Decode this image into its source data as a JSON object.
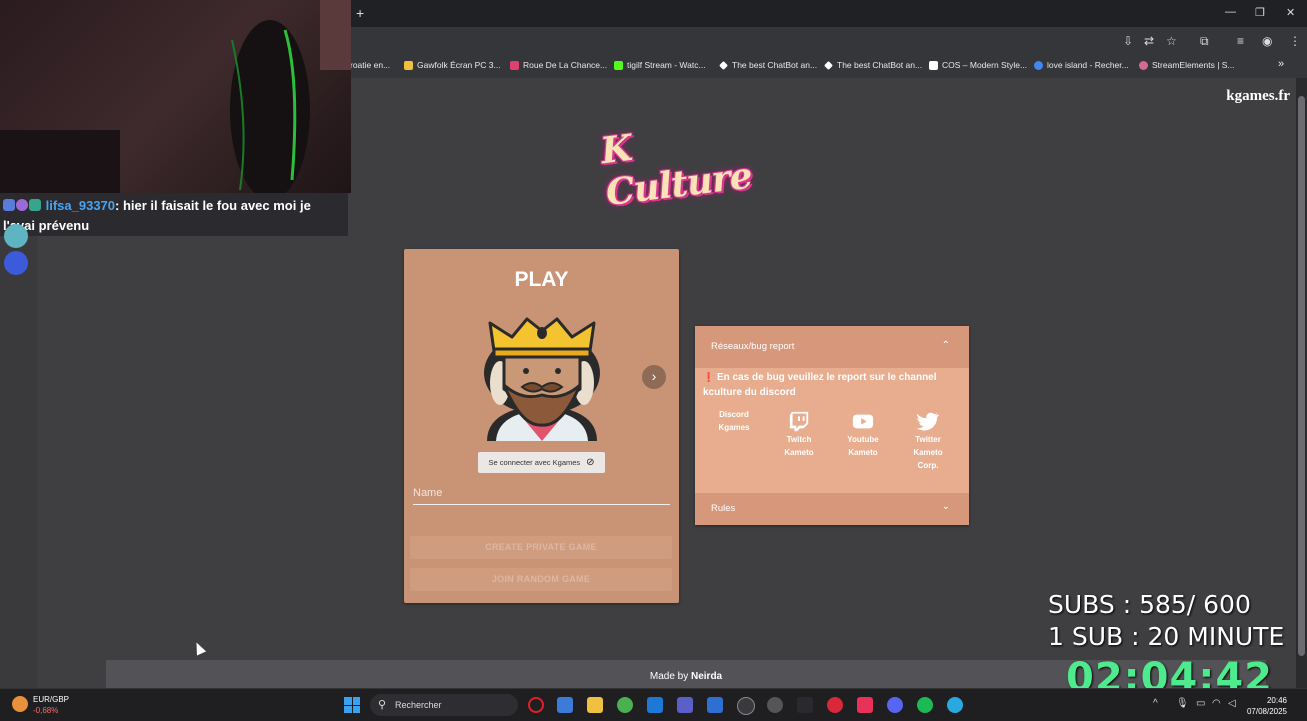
{
  "browser": {
    "new_tab": "+",
    "bookmarks": [
      {
        "label": "roatie en...",
        "color": "#888"
      },
      {
        "label": "Gawfolk Écran PC 3...",
        "color": "#f0c040"
      },
      {
        "label": "Roue De La Chance...",
        "color": "#e04070"
      },
      {
        "label": "tigilf Stream - Watc...",
        "color": "#53fc18"
      },
      {
        "label": "The best ChatBot an...",
        "color": "#ffffff"
      },
      {
        "label": "The best ChatBot an...",
        "color": "#ffffff"
      },
      {
        "label": "COS – Modern Style...",
        "color": "#ffffff"
      },
      {
        "label": "love island - Recher...",
        "color": "#4285f4"
      },
      {
        "label": "StreamElements | S...",
        "color": "#d36b8c"
      }
    ],
    "more": "»"
  },
  "site": {
    "name": "kgames.fr",
    "logo_text": "K Culture"
  },
  "play_card": {
    "title": "PLAY",
    "login_label": "Se connecter avec Kgames",
    "name_placeholder": "Name",
    "create_private": "CREATE PRIVATE GAME",
    "join_random": "JOIN RANDOM GAME"
  },
  "info_panel": {
    "section1_title": "Réseaux/bug report",
    "bug_text": "En cas de bug veuillez le report sur le channel kculture du discord",
    "socials": [
      {
        "line1": "Discord",
        "line2": "Kgames",
        "line3": "",
        "icon": "discord-icon"
      },
      {
        "line1": "Twitch",
        "line2": "Kameto",
        "line3": "",
        "icon": "twitch-icon"
      },
      {
        "line1": "Youtube",
        "line2": "Kameto",
        "line3": "",
        "icon": "youtube-icon"
      },
      {
        "line1": "Twitter",
        "line2": "Kameto",
        "line3": "Corp.",
        "icon": "twitter-icon"
      }
    ],
    "section2_title": "Rules"
  },
  "footer": {
    "prefix": "Made by ",
    "author": "Neirda"
  },
  "stream": {
    "chat_user": "lifsa_93370",
    "chat_message": ": hier il faisait le fou avec moi je l'avai prévenu",
    "subs": "SUBS : 585/ 600",
    "sub_time": "1 SUB :  20 MINUTE",
    "timer": "02:04:42"
  },
  "taskbar": {
    "currency_pair": "EUR/GBP",
    "currency_change": "-0,68%",
    "search_placeholder": "Rechercher",
    "time": "20:46",
    "date": "07/08/2025"
  },
  "colors": {
    "page_bg": "#3f3f42",
    "play_card": "#c99375",
    "info_panel": "#e8ad8f",
    "timer": "#4dea8e"
  }
}
